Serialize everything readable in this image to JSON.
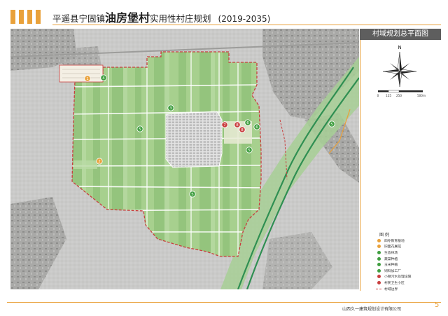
{
  "header": {
    "title_prefix": "平遥县宁固镇",
    "title_village": "油房堡村",
    "title_suffix": "实用性村庄规划",
    "title_years": "(2019-2035)",
    "accent_color": "#e9a13a"
  },
  "side_panel": {
    "title": "村域规划总平面图",
    "north_label": "N",
    "scale_labels": [
      "0",
      "125",
      "250",
      "500m"
    ]
  },
  "legend": {
    "title": "图 例",
    "items": [
      {
        "label": "四冬教育基地",
        "color": "#e9a13a",
        "symbol": "circle"
      },
      {
        "label": "旧面花展馆",
        "color": "#e9a13a",
        "symbol": "circle"
      },
      {
        "label": "生态林场",
        "color": "#3f9e3f",
        "symbol": "circle"
      },
      {
        "label": "蔬菜种植",
        "color": "#3f9e3f",
        "symbol": "circle"
      },
      {
        "label": "玉米种植",
        "color": "#3f9e3f",
        "symbol": "circle"
      },
      {
        "label": "饲料加工厂",
        "color": "#3f9e3f",
        "symbol": "circle"
      },
      {
        "label": "小微污水处理设施",
        "color": "#c93e3e",
        "symbol": "circle"
      },
      {
        "label": "村民卫生小区",
        "color": "#c93e3e",
        "symbol": "circle"
      },
      {
        "label": "村域边界",
        "color": "#c93e3e",
        "symbol": "dashed-line"
      }
    ]
  },
  "map": {
    "markers": [
      {
        "number": "1",
        "color": "#e9a13a"
      },
      {
        "number": "2",
        "color": "#e9a13a"
      },
      {
        "number": "3",
        "color": "#3f9e3f"
      },
      {
        "number": "4",
        "color": "#3f9e3f"
      },
      {
        "number": "5",
        "color": "#3f9e3f"
      },
      {
        "number": "5",
        "color": "#3f9e3f"
      },
      {
        "number": "5",
        "color": "#3f9e3f"
      },
      {
        "number": "5",
        "color": "#3f9e3f"
      },
      {
        "number": "6",
        "color": "#3f9e3f"
      },
      {
        "number": "6",
        "color": "#3f9e3f"
      },
      {
        "number": "7",
        "color": "#c93e3e"
      },
      {
        "number": "8",
        "color": "#c93e3e"
      },
      {
        "number": "8",
        "color": "#c93e3e"
      }
    ]
  },
  "footer": {
    "company": "山西久一建筑规划设计有限公司",
    "page_number": "5"
  }
}
